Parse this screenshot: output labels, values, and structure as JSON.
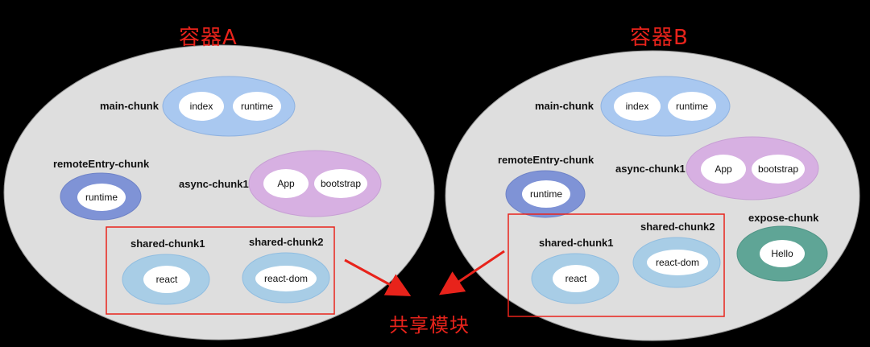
{
  "title_a": "容器A",
  "title_b": "容器B",
  "shared_title": "共享模块",
  "container_a": {
    "main_chunk": {
      "label": "main-chunk",
      "modules": [
        "index",
        "runtime"
      ]
    },
    "remote_entry_chunk": {
      "label": "remoteEntry-chunk",
      "modules": [
        "runtime"
      ]
    },
    "async_chunk1": {
      "label": "async-chunk1",
      "modules": [
        "App",
        "bootstrap"
      ]
    },
    "shared_chunk1": {
      "label": "shared-chunk1",
      "modules": [
        "react"
      ]
    },
    "shared_chunk2": {
      "label": "shared-chunk2",
      "modules": [
        "react-dom"
      ]
    }
  },
  "container_b": {
    "main_chunk": {
      "label": "main-chunk",
      "modules": [
        "index",
        "runtime"
      ]
    },
    "remote_entry_chunk": {
      "label": "remoteEntry-chunk",
      "modules": [
        "runtime"
      ]
    },
    "async_chunk1": {
      "label": "async-chunk1",
      "modules": [
        "App",
        "bootstrap"
      ]
    },
    "expose_chunk": {
      "label": "expose-chunk",
      "modules": [
        "Hello"
      ]
    },
    "shared_chunk1": {
      "label": "shared-chunk1",
      "modules": [
        "react"
      ]
    },
    "shared_chunk2": {
      "label": "shared-chunk2",
      "modules": [
        "react-dom"
      ]
    }
  },
  "colors": {
    "container_fill": "#dedede",
    "main_chunk": "#a9c8f0",
    "remote_entry_chunk": "#7f93d6",
    "async_chunk": "#d7b0e2",
    "shared_chunk": "#a8cde6",
    "expose_chunk": "#5fa596",
    "highlight": "#e8231b"
  }
}
